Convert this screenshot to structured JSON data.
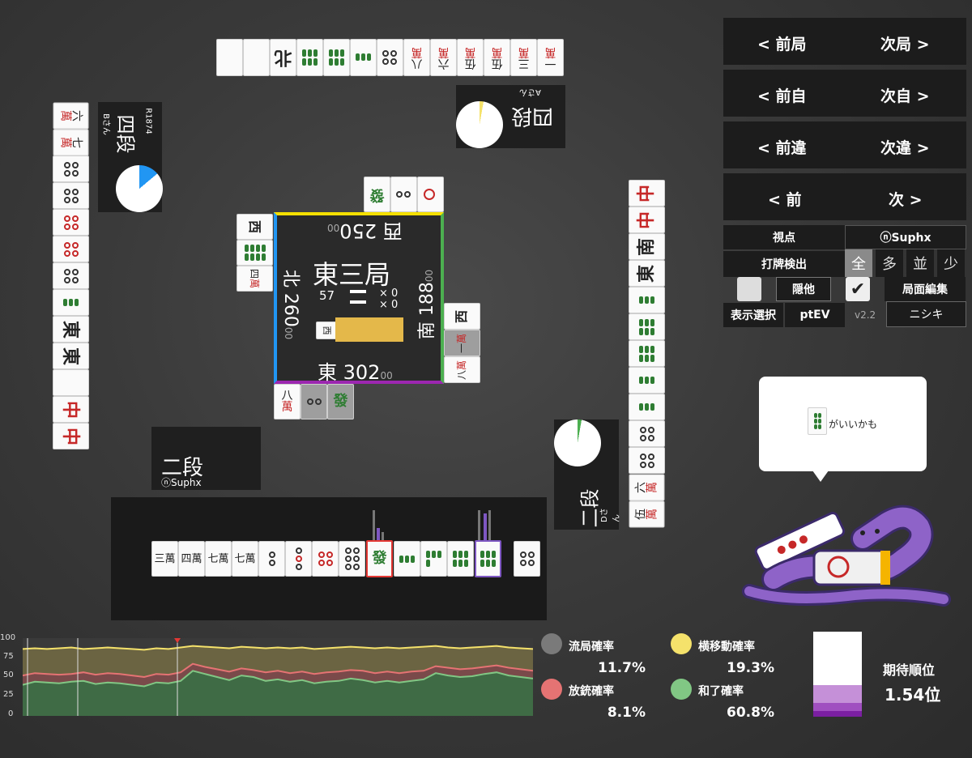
{
  "nav": {
    "prev_round": "< 前局",
    "next_round": "次局 >",
    "prev_self": "< 前自",
    "next_self": "次自 >",
    "prev_diff": "< 前違",
    "next_diff": "次違 >",
    "prev": "< 前",
    "next": "次 >"
  },
  "view": {
    "label": "視点",
    "value": "ⓝSuphx"
  },
  "detect": {
    "label": "打牌検出",
    "options": [
      "全",
      "多",
      "並",
      "少"
    ],
    "selected": "全"
  },
  "toggles": {
    "hide_others": "隠他",
    "board_edit": "局面編集"
  },
  "display": {
    "label": "表示選択",
    "value": "ptEV",
    "version": "v2.2",
    "mode": "ニシキ"
  },
  "center": {
    "round": "東三局",
    "honba": "57",
    "counter_a": "× 0",
    "counter_b": "× 0",
    "east_score": "東 302",
    "south_score": "南 188",
    "west_score": "西 250",
    "north_score": "北 260",
    "score_suffix": "00"
  },
  "players": {
    "self": {
      "rank": "二段",
      "name": "ⓝSuphx"
    },
    "left": {
      "rank": "四段",
      "name": "Bさん",
      "rating": "R1874"
    },
    "top": {
      "rank": "四段",
      "name": "Aさん"
    },
    "right": {
      "rank": "二段",
      "name": "Dさん"
    }
  },
  "speech": {
    "text": "がいいかも"
  },
  "hand": [
    "三萬",
    "四萬",
    "七萬",
    "七萬",
    "2p",
    "3p",
    "5p",
    "8p",
    "發",
    "3s",
    "4s",
    "6s",
    "7s",
    "4p"
  ],
  "stats": {
    "ryukyoku": {
      "label": "流局確率",
      "value": "11.7%",
      "color": "#7a7a7a"
    },
    "yoko": {
      "label": "横移動確率",
      "value": "19.3%",
      "color": "#f5e26b"
    },
    "houju": {
      "label": "放銃確率",
      "value": "8.1%",
      "color": "#e57373"
    },
    "agari": {
      "label": "和了確率",
      "value": "60.8%",
      "color": "#81c784"
    },
    "expected_rank_label": "期待順位",
    "expected_rank": "1.54位"
  },
  "graph": {
    "y_ticks": [
      "100",
      "75",
      "50",
      "25",
      "0"
    ]
  },
  "chart_data": {
    "type": "area",
    "ylim": [
      0,
      100
    ],
    "y_ticks": [
      100,
      75,
      50,
      25,
      0
    ],
    "series": [
      {
        "values": [
          86,
          87,
          86,
          87,
          88,
          86,
          87,
          88,
          87,
          86,
          85,
          87,
          86,
          88,
          90,
          89,
          88,
          87,
          89,
          88,
          87,
          88,
          87,
          88,
          86,
          87,
          88,
          89,
          88,
          87,
          88,
          87,
          88,
          89,
          90,
          88,
          87,
          88,
          89,
          90,
          88,
          87,
          86
        ]
      },
      {
        "values": [
          52,
          55,
          54,
          53,
          54,
          56,
          53,
          55,
          54,
          52,
          50,
          54,
          53,
          56,
          67,
          63,
          60,
          57,
          61,
          59,
          56,
          58,
          55,
          57,
          54,
          56,
          57,
          59,
          58,
          55,
          57,
          55,
          57,
          58,
          64,
          62,
          60,
          61,
          63,
          65,
          62,
          60,
          58
        ]
      },
      {
        "values": [
          40,
          44,
          43,
          42,
          44,
          45,
          41,
          43,
          42,
          40,
          38,
          43,
          42,
          45,
          58,
          54,
          50,
          46,
          52,
          50,
          45,
          47,
          44,
          46,
          42,
          44,
          45,
          48,
          46,
          43,
          45,
          43,
          45,
          47,
          55,
          52,
          50,
          51,
          54,
          56,
          52,
          50,
          48
        ]
      }
    ]
  }
}
